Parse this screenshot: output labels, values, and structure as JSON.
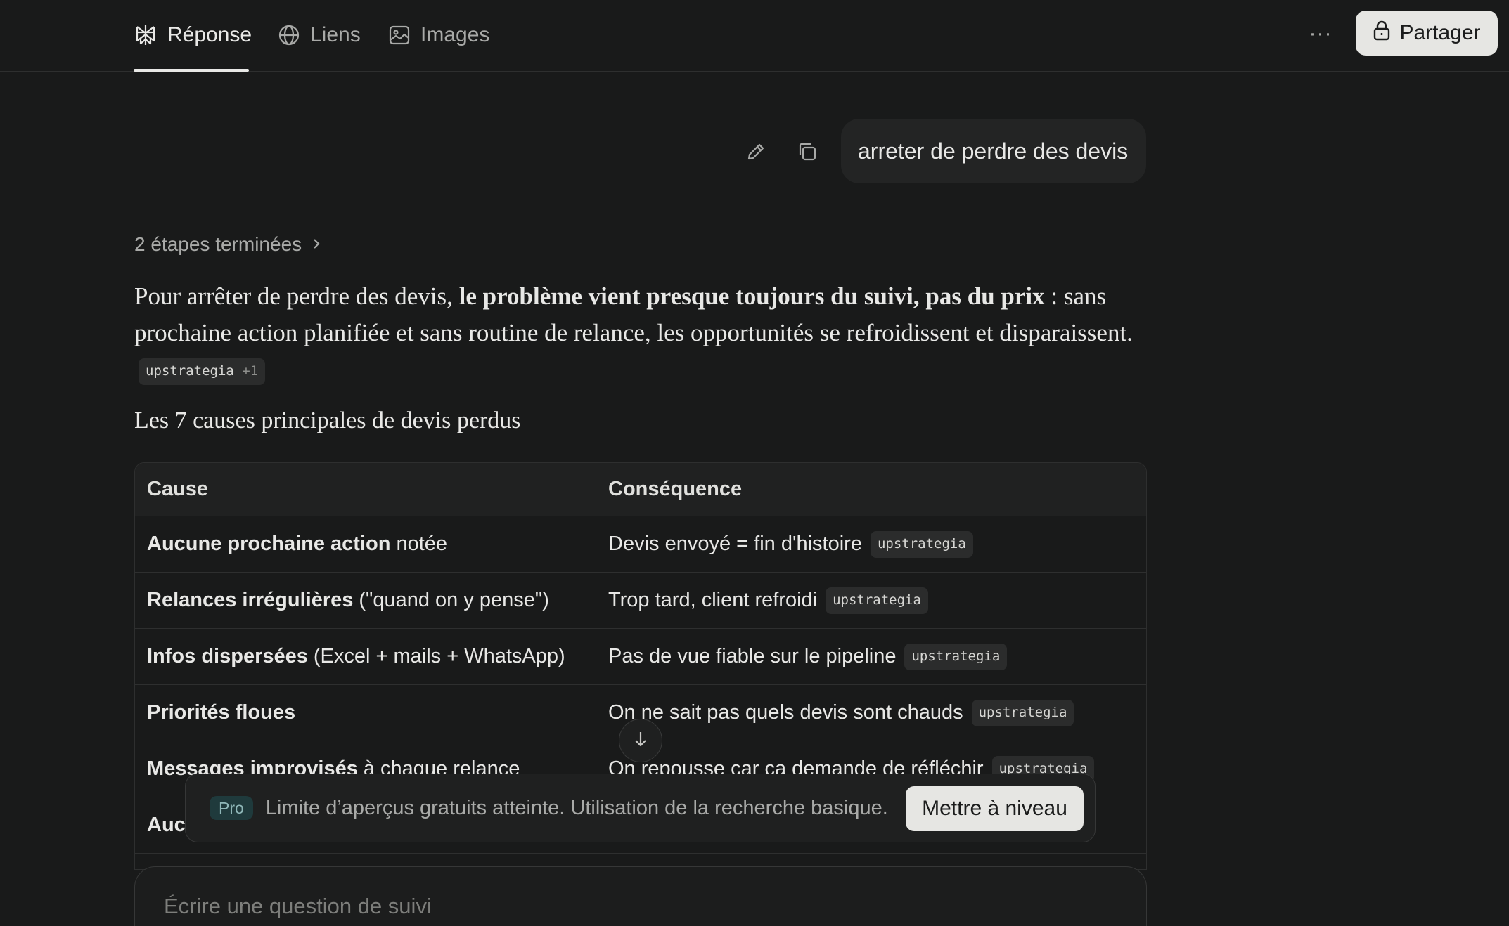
{
  "tabs": [
    {
      "label": "Réponse",
      "icon": "perplexity-icon",
      "active": true
    },
    {
      "label": "Liens",
      "icon": "globe-icon",
      "active": false
    },
    {
      "label": "Images",
      "icon": "image-icon",
      "active": false
    }
  ],
  "header": {
    "more_label": "···",
    "share_label": "Partager",
    "share_icon": "lock-icon"
  },
  "query": {
    "text": "arreter de perdre des devis",
    "edit_icon": "pencil-icon",
    "copy_icon": "copy-icon"
  },
  "steps": {
    "label": "2 étapes terminées",
    "icon": "chevron-right-icon"
  },
  "answer": {
    "intro": "Pour arrêter de perdre des devis, ",
    "bold": "le problème vient presque toujours du suivi, pas du prix",
    "rest": " : sans prochaine action planifiée et sans routine de relance, les opportunités se refroidissent et disparaissent.",
    "citation": "upstrategia",
    "citation_extra": "+1"
  },
  "section_title": "Les 7 causes principales de devis perdus",
  "table": {
    "headers": [
      "Cause",
      "Conséquence"
    ],
    "rows": [
      {
        "cause_bold": "Aucune prochaine action",
        "cause_rest": "notée",
        "consequence": "Devis envoyé = fin d'histoire",
        "citation": "upstrategia"
      },
      {
        "cause_bold": "Relances irrégulières",
        "cause_rest": "(\"quand on y pense\")",
        "consequence": "Trop tard, client refroidi",
        "citation": "upstrategia"
      },
      {
        "cause_bold": "Infos dispersées",
        "cause_rest": "(Excel + mails + WhatsApp)",
        "consequence": "Pas de vue fiable sur le pipeline",
        "citation": "upstrategia"
      },
      {
        "cause_bold": "Priorités floues",
        "cause_rest": "",
        "consequence": "On ne sait pas quels devis sont chauds",
        "citation": "upstrategia"
      },
      {
        "cause_bold": "Messages improvisés",
        "cause_rest": "à chaque relance",
        "consequence": "On repousse car ça demande de réfléchir",
        "citation": "upstrategia"
      },
      {
        "cause_bold": "Auc",
        "cause_rest": "",
        "consequence": "",
        "citation": ""
      }
    ]
  },
  "pro_banner": {
    "badge": "Pro",
    "text": "Limite d’aperçus gratuits atteinte. Utilisation de la recherche basique.",
    "button": "Mettre à niveau"
  },
  "followup": {
    "placeholder": "Écrire une question de suivi"
  },
  "scroll_icon": "arrow-down-icon"
}
